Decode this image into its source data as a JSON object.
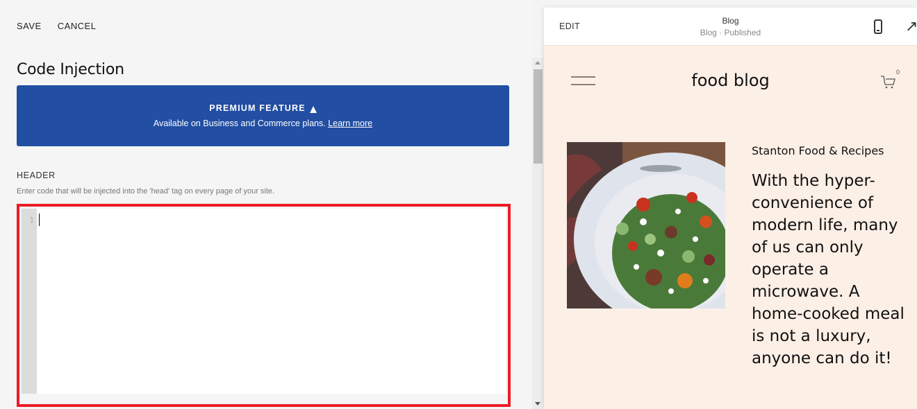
{
  "toolbar": {
    "save_label": "SAVE",
    "cancel_label": "CANCEL"
  },
  "page": {
    "title": "Code Injection"
  },
  "premium": {
    "title": "PREMIUM FEATURE",
    "icon": "premium-arrow-icon",
    "description": "Available on Business and Commerce plans.",
    "link_label": "Learn more",
    "bg_color": "#224ea3"
  },
  "header_section": {
    "label": "HEADER",
    "description": "Enter code that will be injected into the 'head' tag on every page of your site.",
    "editor": {
      "line_numbers": [
        "1"
      ],
      "value": "",
      "highlight_color": "#ed1c24"
    }
  },
  "preview": {
    "edit_label": "EDIT",
    "page_title": "Blog",
    "page_status": "Blog · Published",
    "mobile_icon": "mobile-device-icon",
    "external_icon": "external-link-icon",
    "external_glyph": "↗",
    "site": {
      "title": "food blog",
      "cart_count": "0",
      "brand": "Stanton Food & Recipes",
      "intro": "With the hyper-convenience of modern life, many of us can only operate a microwave. A home-cooked meal is not a luxury, anyone can do it!",
      "image_alt": "salad bowl photo",
      "bg_color": "#fcefe6"
    }
  }
}
